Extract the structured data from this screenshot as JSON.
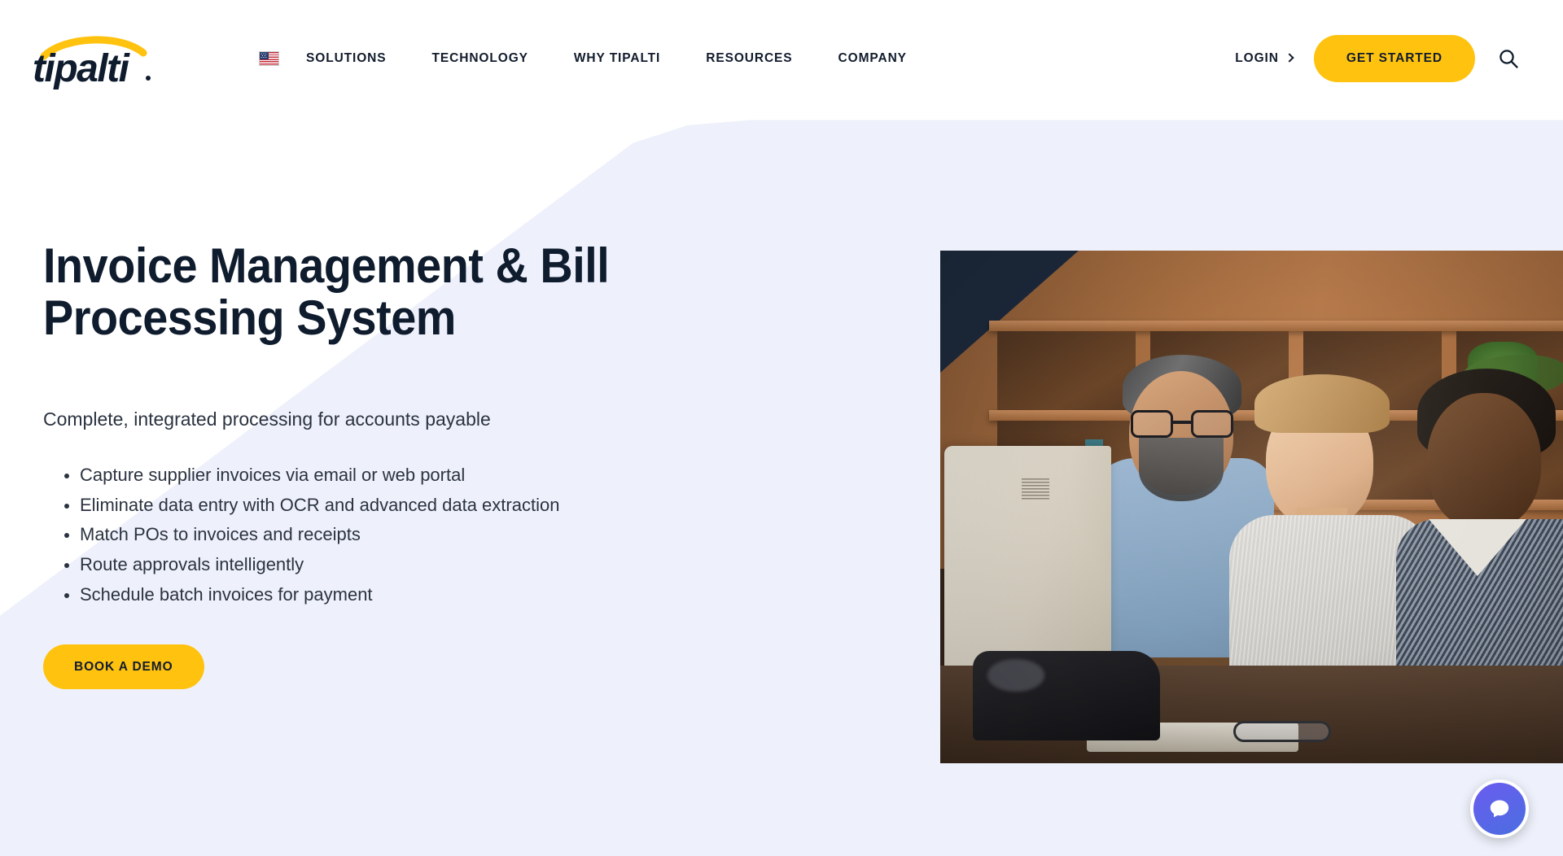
{
  "brand": {
    "logo_text": "tipalti",
    "logo_name": "tipalti-logo",
    "accent_yellow": "#FFC20E",
    "navy": "#0F1C2E",
    "hero_bg": "#EEF1FB"
  },
  "header": {
    "locale_flag": "us-flag-icon",
    "nav": [
      {
        "label": "SOLUTIONS",
        "name": "nav-item-solutions"
      },
      {
        "label": "TECHNOLOGY",
        "name": "nav-item-technology"
      },
      {
        "label": "WHY TIPALTI",
        "name": "nav-item-why-tipalti"
      },
      {
        "label": "RESOURCES",
        "name": "nav-item-resources"
      },
      {
        "label": "COMPANY",
        "name": "nav-item-company"
      }
    ],
    "login_label": "LOGIN",
    "login_chevron": "chevron-right-icon",
    "cta_label": "GET STARTED",
    "search_icon": "search-icon"
  },
  "hero": {
    "title": "Invoice Management & Bill\nProcessing System",
    "subtitle": "Complete, integrated processing for accounts payable",
    "bullets": [
      "Capture supplier invoices via email or web portal",
      "Eliminate data entry with OCR and advanced data extraction",
      "Match POs to invoices and receipts",
      "Route approvals intelligently",
      "Schedule batch invoices for payment"
    ],
    "demo_button": "BOOK A DEMO",
    "image_alt": "Three colleagues smiling while working together at a desk with a desktop computer and tablet in a modern office"
  },
  "chat": {
    "icon": "chat-bubble-icon",
    "accent": "#5A63EE"
  }
}
